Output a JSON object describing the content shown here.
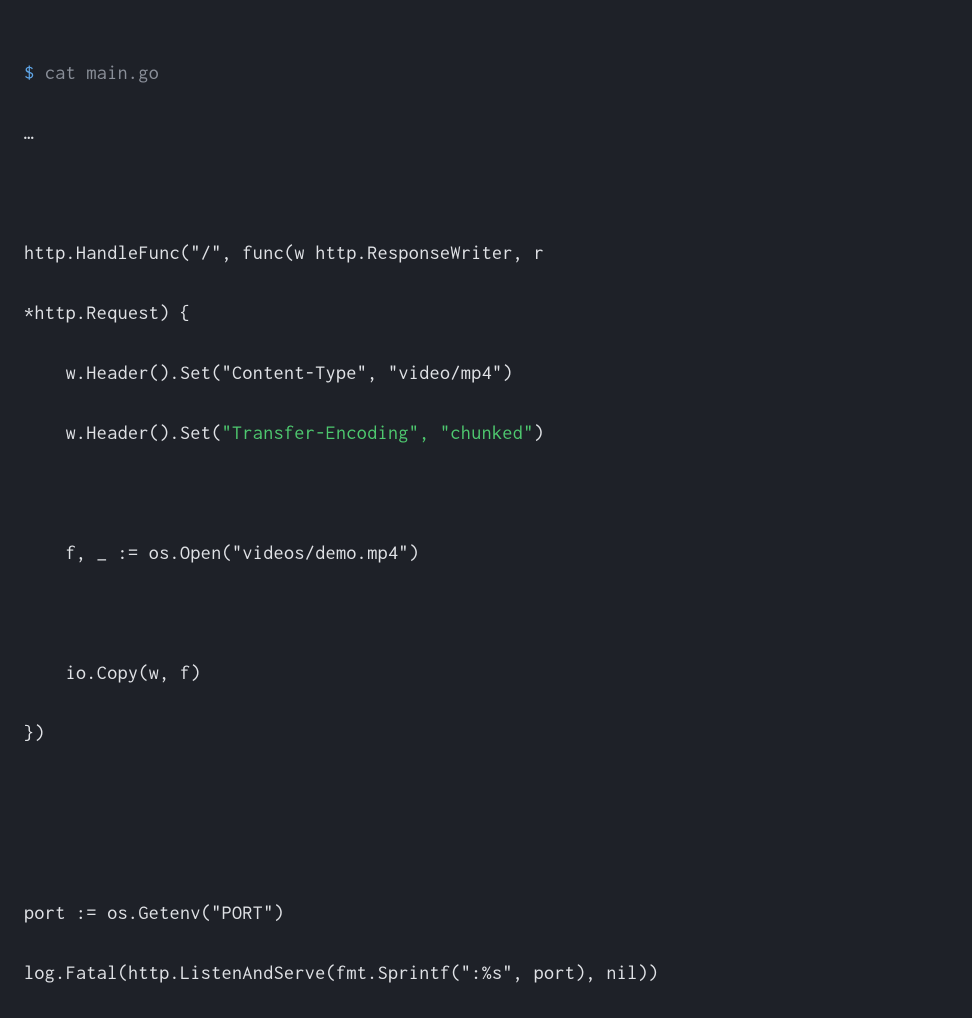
{
  "terminal": {
    "prompt": "$",
    "command": "cat main.go",
    "ellipsis": "…",
    "code": {
      "line1": "http.HandleFunc(\"/\", func(w http.ResponseWriter, r",
      "line2": "*http.Request) {",
      "line3_prefix": "    w.Header().Set(\"Content-Type\", \"video/mp4\")",
      "line4_prefix": "    w.Header().Set(",
      "line4_highlight": "\"Transfer-Encoding\", \"chunked\"",
      "line4_suffix": ")",
      "line5": "",
      "line6": "    f, _ := os.Open(\"videos/demo.mp4\")",
      "line7": "",
      "line8": "    io.Copy(w, f)",
      "line9": "})",
      "line10": "",
      "line11": "",
      "line12": "port := os.Getenv(\"PORT\")",
      "line13": "log.Fatal(http.ListenAndServe(fmt.Sprintf(\":%s\", port), nil))"
    }
  }
}
